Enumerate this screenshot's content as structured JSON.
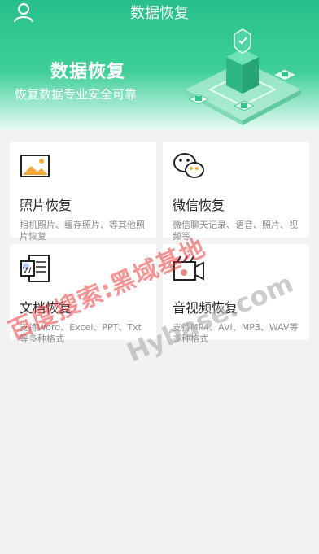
{
  "header": {
    "title": "数据恢复",
    "hero_title": "数据恢复",
    "hero_subtitle": "恢复数据专业安全可靠"
  },
  "cards": [
    {
      "title": "照片恢复",
      "desc": "相机照片、缓存照片、等其他照片恢复",
      "icon": "image-icon"
    },
    {
      "title": "微信恢复",
      "desc": "微信聊天记录、语音、照片、视频等",
      "icon": "wechat-icon"
    },
    {
      "title": "文档恢复",
      "desc": "支持Word、Excel、PPT、Txt等多种格式",
      "icon": "word-doc-icon"
    },
    {
      "title": "音视频恢复",
      "desc": "支持MP4、AVI、MP3、WAV等多种格式",
      "icon": "video-icon"
    }
  ],
  "watermark": {
    "red": "百度搜索:黑域基地",
    "gray": "Hybase.com"
  },
  "colors": {
    "header_green": "#27c08a",
    "background": "#f2f2f2"
  }
}
